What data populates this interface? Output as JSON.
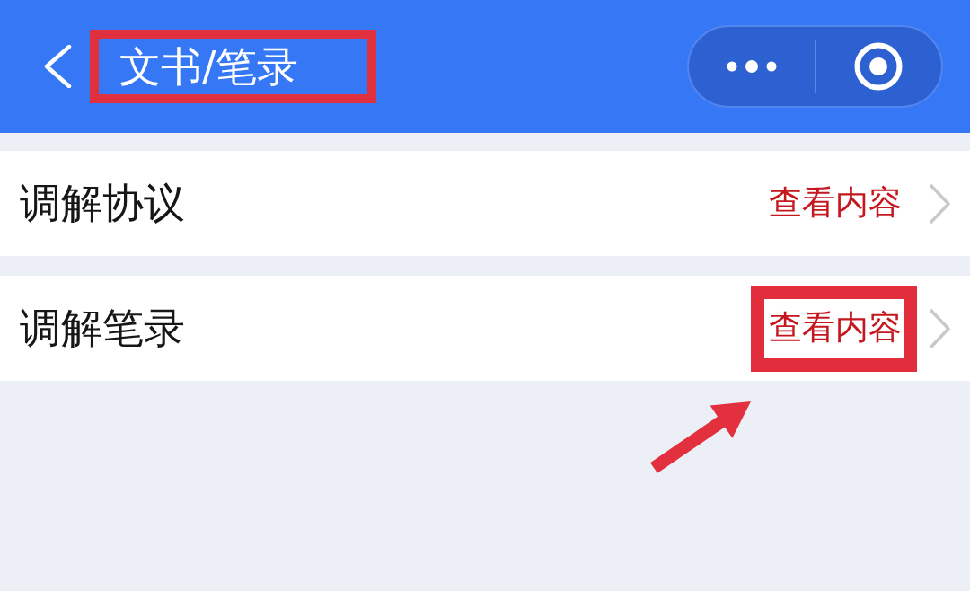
{
  "header": {
    "title": {
      "text": "文书/笔录",
      "highlighted": true
    }
  },
  "rows": [
    {
      "label": "调解协议",
      "link": "查看内容",
      "highlighted": false
    },
    {
      "label": "调解笔录",
      "link": "查看内容",
      "highlighted": true
    }
  ]
}
